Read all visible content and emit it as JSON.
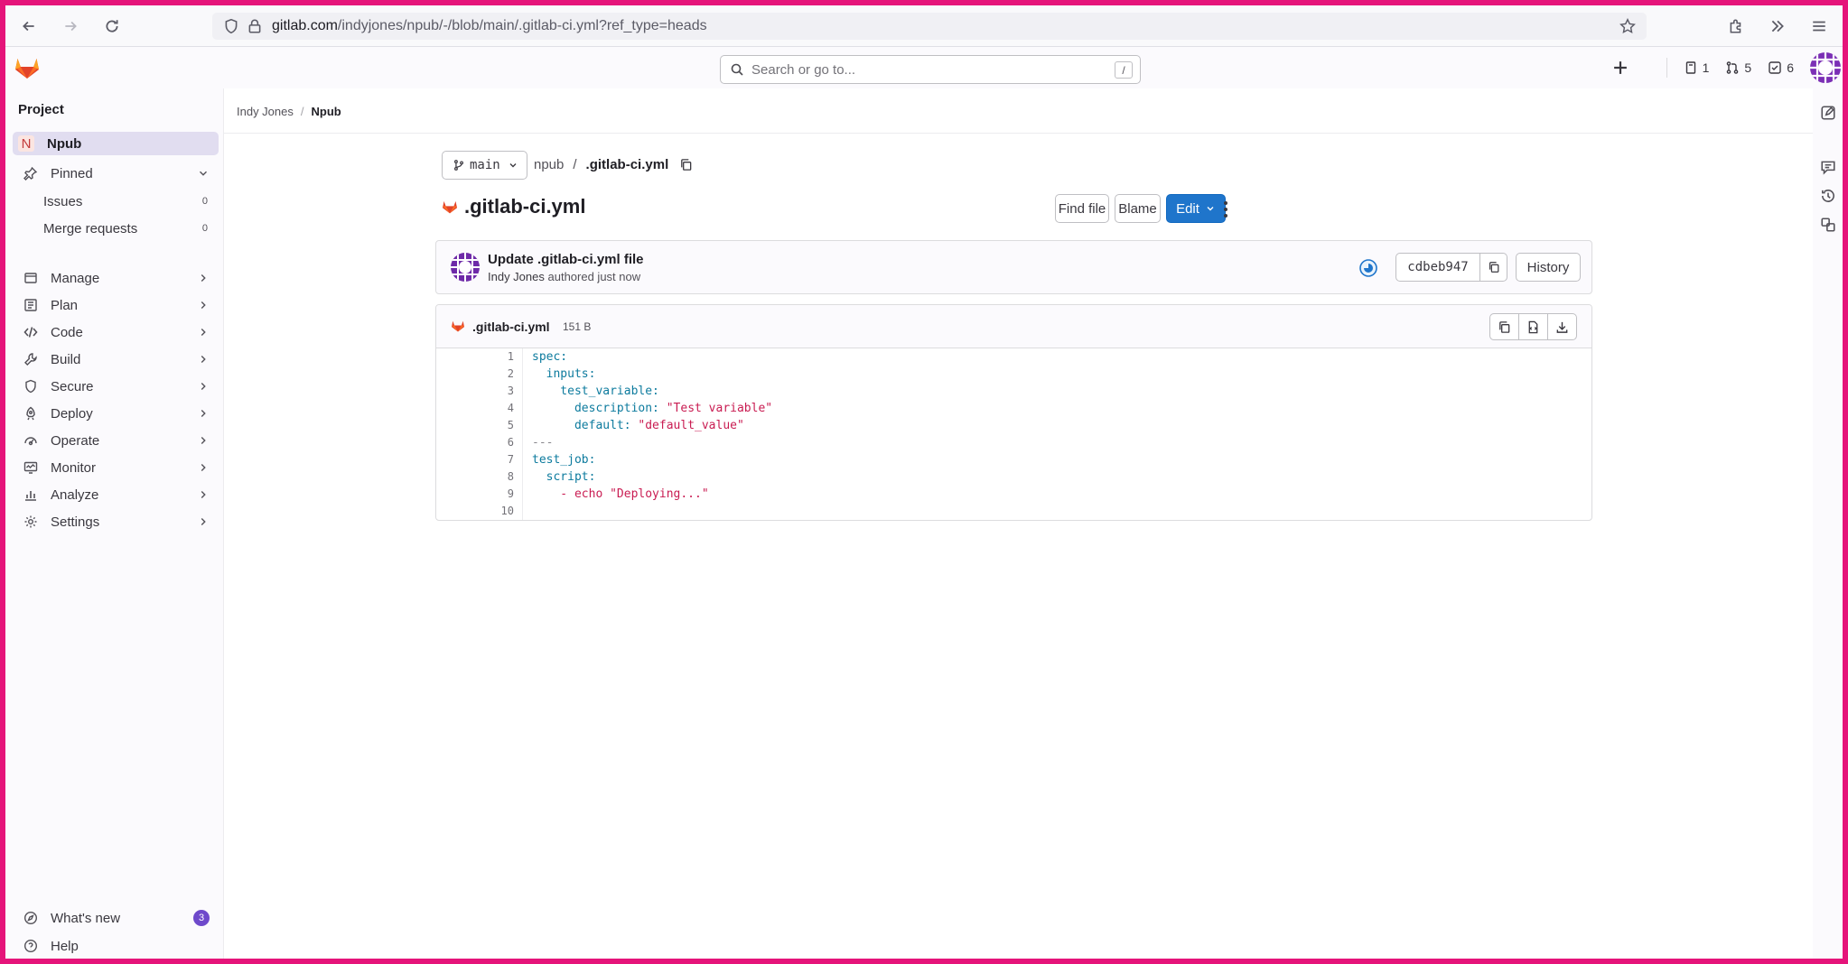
{
  "browser": {
    "url_host": "gitlab.com",
    "url_path": "/indyjones/npub/-/blob/main/.gitlab-ci.yml?ref_type=heads"
  },
  "header": {
    "search_placeholder": "Search or go to...",
    "search_shortcut": "/",
    "issues_count": "1",
    "merge_requests_count": "5",
    "todos_count": "6"
  },
  "sidebar": {
    "title": "Project",
    "project_letter": "N",
    "project_name": "Npub",
    "pinned_label": "Pinned",
    "pinned_items": [
      {
        "label": "Issues",
        "count": "0"
      },
      {
        "label": "Merge requests",
        "count": "0"
      }
    ],
    "sections": [
      {
        "label": "Manage",
        "icon": "manage-icon"
      },
      {
        "label": "Plan",
        "icon": "plan-icon"
      },
      {
        "label": "Code",
        "icon": "code-icon"
      },
      {
        "label": "Build",
        "icon": "build-icon"
      },
      {
        "label": "Secure",
        "icon": "shield-icon"
      },
      {
        "label": "Deploy",
        "icon": "deploy-icon"
      },
      {
        "label": "Operate",
        "icon": "operate-icon"
      },
      {
        "label": "Monitor",
        "icon": "monitor-icon"
      },
      {
        "label": "Analyze",
        "icon": "chart-icon"
      },
      {
        "label": "Settings",
        "icon": "gear-icon"
      }
    ],
    "whats_new_label": "What's new",
    "whats_new_count": "3",
    "help_label": "Help"
  },
  "breadcrumb": {
    "owner": "Indy Jones",
    "project": "Npub"
  },
  "file": {
    "branch": "main",
    "path_root": "npub",
    "path_sep": "/",
    "name": ".gitlab-ci.yml",
    "size": "151 B",
    "find_file_label": "Find file",
    "blame_label": "Blame",
    "edit_label": "Edit"
  },
  "commit": {
    "title": "Update .gitlab-ci.yml file",
    "author": "Indy Jones",
    "authored_text": "authored just now",
    "sha": "cdbeb947",
    "history_label": "History"
  },
  "code_lines": [
    {
      "n": "1",
      "text": "spec:"
    },
    {
      "n": "2",
      "text": "  inputs:"
    },
    {
      "n": "3",
      "text": "    test_variable:"
    },
    {
      "n": "4",
      "text": "      description: \"Test variable\""
    },
    {
      "n": "5",
      "text": "      default: \"default_value\""
    },
    {
      "n": "6",
      "text": "---"
    },
    {
      "n": "7",
      "text": "test_job:"
    },
    {
      "n": "8",
      "text": "  script:"
    },
    {
      "n": "9",
      "text": "    - echo \"Deploying...\""
    },
    {
      "n": "10",
      "text": ""
    }
  ],
  "colors": {
    "accent_blue": "#1f75cb",
    "frame_pink": "#e5147a",
    "badge_purple": "#6e49cb"
  }
}
